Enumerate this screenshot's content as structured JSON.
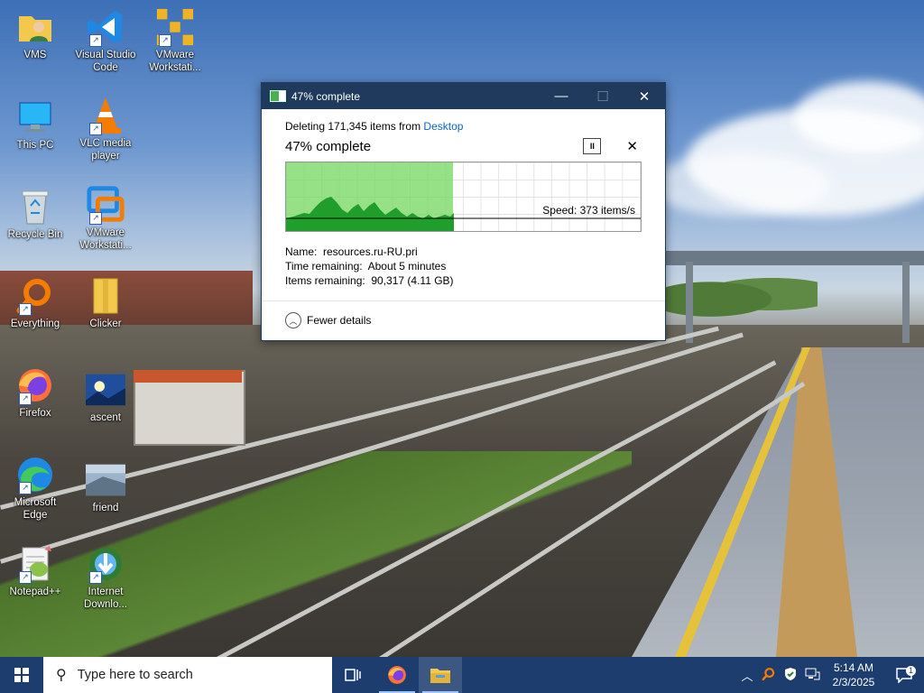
{
  "desktop": {
    "icons": [
      {
        "label": "VMS",
        "icon": "user-folder-icon"
      },
      {
        "label": "Visual Studio Code",
        "icon": "vscode-icon"
      },
      {
        "label": "VMware Workstati...",
        "icon": "vmware-icon"
      },
      {
        "label": "This PC",
        "icon": "computer-icon"
      },
      {
        "label": "VLC media player",
        "icon": "vlc-icon"
      },
      {
        "label": "Recycle Bin",
        "icon": "recycle-bin-icon"
      },
      {
        "label": "VMware Workstati...",
        "icon": "vmware-workstation-icon"
      },
      {
        "label": "Everything",
        "icon": "everything-search-icon"
      },
      {
        "label": "Clicker",
        "icon": "folder-icon"
      },
      {
        "label": "Firefox",
        "icon": "firefox-icon"
      },
      {
        "label": "ascent",
        "icon": "ascent-image-icon"
      },
      {
        "label": "Microsoft Edge",
        "icon": "edge-icon"
      },
      {
        "label": "friend",
        "icon": "friend-image-icon"
      },
      {
        "label": "Notepad++",
        "icon": "notepadpp-icon"
      },
      {
        "label": "Internet Downlo...",
        "icon": "idm-icon"
      }
    ]
  },
  "dialog": {
    "title": "47% complete",
    "deleting_prefix": "Deleting 171,345 items from ",
    "deleting_link": "Desktop",
    "percent_text": "47% complete",
    "progress_fraction": 0.47,
    "pause_symbol": "II",
    "cancel_symbol": "✕",
    "speed": "Speed: 373 items/s",
    "name_label": "Name:",
    "name_value": "resources.ru-RU.pri",
    "time_label": "Time remaining:",
    "time_value": "About 5 minutes",
    "items_label": "Items remaining:",
    "items_value": "90,317 (4.11 GB)",
    "fewer_details": "Fewer details",
    "controls": {
      "minimize": "—",
      "maximize": "☐",
      "close": "✕"
    }
  },
  "taskbar": {
    "search_placeholder": "Type here to search",
    "apps": [
      {
        "name": "task-view",
        "icon": "task-view-icon"
      },
      {
        "name": "firefox",
        "icon": "firefox-icon"
      },
      {
        "name": "file-explorer",
        "icon": "file-explorer-icon",
        "active": true
      }
    ],
    "tray": {
      "time": "5:14 AM",
      "date": "2/3/2025",
      "notification_count": "1"
    }
  },
  "colors": {
    "title_bar": "#1f3a5c",
    "taskbar": "#1d3d6e",
    "progress_green": "#78d764",
    "link_blue": "#0a64c8"
  }
}
